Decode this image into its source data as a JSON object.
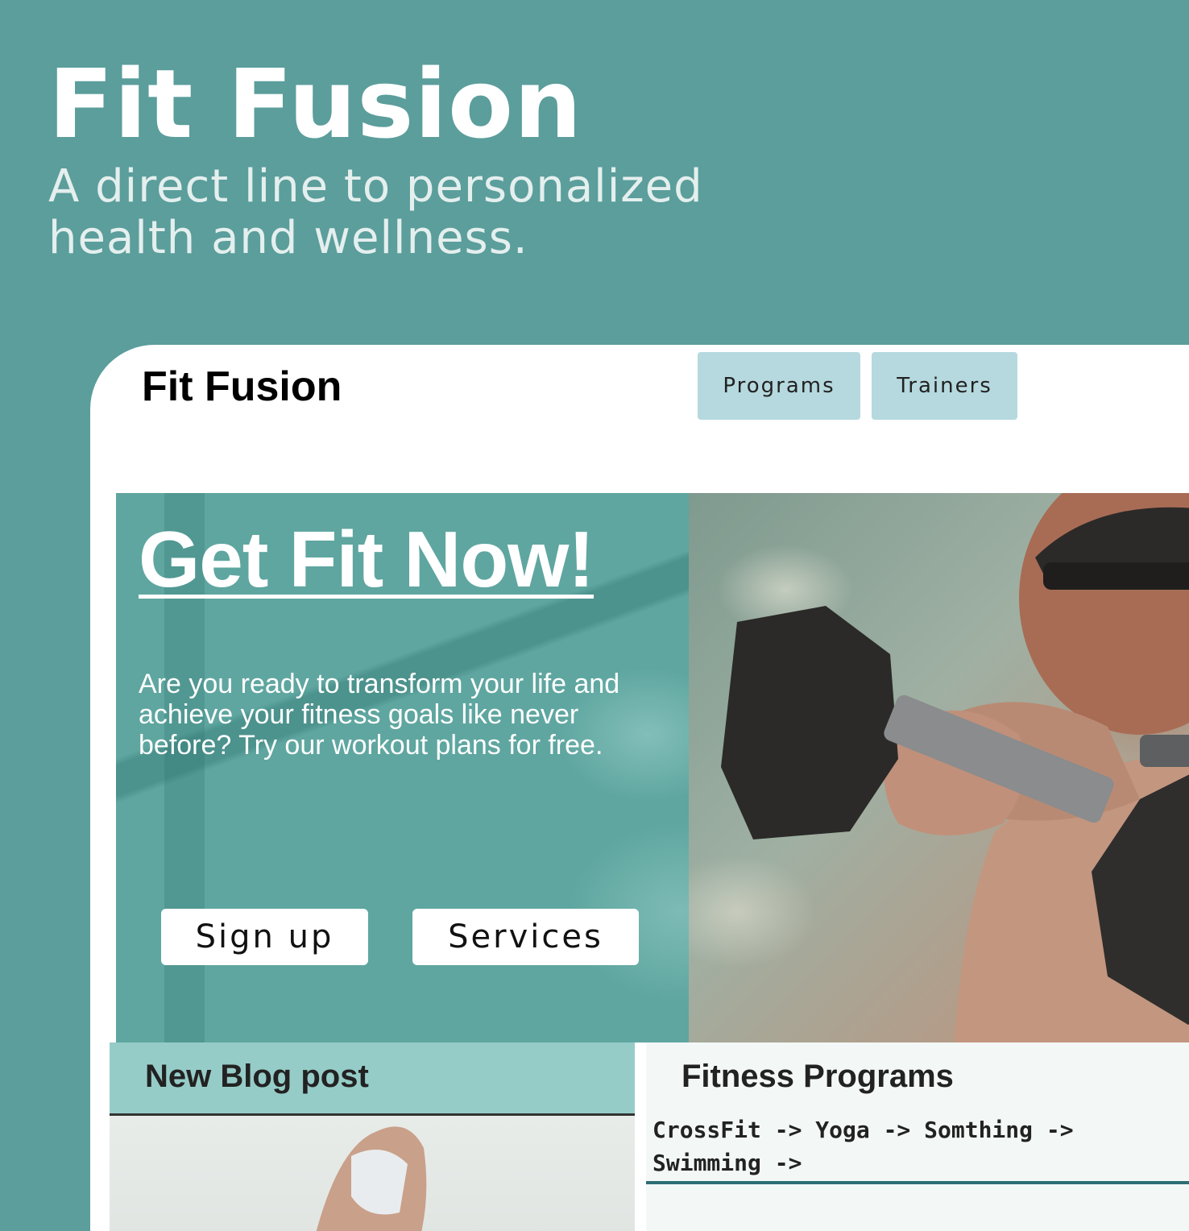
{
  "promo": {
    "title": "Fit Fusion",
    "tagline": "A direct line to personalized health and wellness."
  },
  "site": {
    "logo": "Fit Fusion",
    "nav": [
      {
        "label": "Programs"
      },
      {
        "label": "Trainers"
      }
    ]
  },
  "hero": {
    "title": "Get Fit Now!",
    "text": "Are you ready to transform your life and achieve your fitness goals like never before? Try our workout plans for free.",
    "buttons": {
      "signup": "Sign up",
      "services": "Services"
    }
  },
  "blog": {
    "title": "New Blog post"
  },
  "programs": {
    "title": "Fitness Programs",
    "list": "CrossFit -> Yoga -> Somthing -> Swimming ->"
  },
  "colors": {
    "background": "#5b9e9c",
    "nav_button": "#b5d9de",
    "hero_panel": "#5fa6a0",
    "blog_header": "#96ccc8",
    "accent_line": "#2d6e74"
  }
}
